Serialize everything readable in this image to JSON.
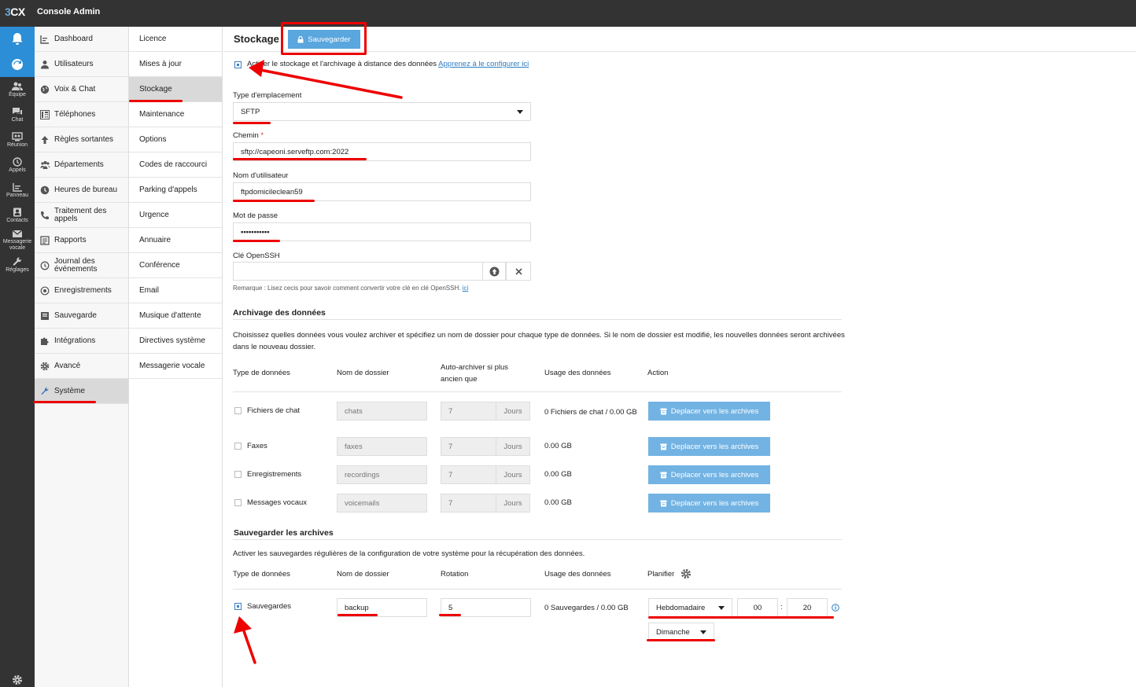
{
  "app": {
    "logo_prefix": "3",
    "logo_suffix": "CX",
    "title": "Console Admin"
  },
  "iconbar": [
    {
      "label": "",
      "icon": "bell-icon"
    },
    {
      "label": "",
      "icon": "refresh-icon"
    },
    {
      "label": "Équipe",
      "icon": "team-icon"
    },
    {
      "label": "Chat",
      "icon": "chat-icon"
    },
    {
      "label": "Réunion",
      "icon": "meeting-icon"
    },
    {
      "label": "Appels",
      "icon": "history-icon"
    },
    {
      "label": "Panneau",
      "icon": "panel-icon"
    },
    {
      "label": "Contacts",
      "icon": "contacts-icon"
    },
    {
      "label": "Messagerie vocale",
      "icon": "mail-icon"
    },
    {
      "label": "Réglages",
      "icon": "wrench-icon"
    }
  ],
  "nav_primary": [
    "Dashboard",
    "Utilisateurs",
    "Voix & Chat",
    "Téléphones",
    "Règles sortantes",
    "Départements",
    "Heures de bureau",
    "Traitement des appels",
    "Rapports",
    "Journal des événements",
    "Enregistrements",
    "Sauvegarde",
    "Intégrations",
    "Avancé",
    "Système"
  ],
  "nav_primary_active": "Système",
  "nav_secondary": [
    "Licence",
    "Mises à jour",
    "Stockage",
    "Maintenance",
    "Options",
    "Codes de raccourci",
    "Parking d'appels",
    "Urgence",
    "Annuaire",
    "Conférence",
    "Email",
    "Musique d'attente",
    "Directives système",
    "Messagerie vocale"
  ],
  "nav_secondary_active": "Stockage",
  "page": {
    "title": "Stockage",
    "save_label": "Sauvegarder"
  },
  "remote": {
    "checkbox_label": "Activer le stockage et l'archivage à distance des données",
    "learn_more": "Apprenez à le configurer ici",
    "checked": true
  },
  "location": {
    "label": "Type d'emplacement",
    "value": "SFTP"
  },
  "path": {
    "label": "Chemin",
    "required_mark": "*",
    "value": "sftp://capeoni.serveftp.com:2022"
  },
  "username": {
    "label": "Nom d'utilisateur",
    "value": "ftpdomicileclean59"
  },
  "password": {
    "label": "Mot de passe",
    "value": "•••••••••••"
  },
  "openssh": {
    "label": "Clé OpenSSH",
    "value": "",
    "note": "Remarque : Lisez cecis pour savoir comment convertir votre clé en clé OpenSSH.",
    "note_link": "ici"
  },
  "archiving": {
    "title": "Archivage des données",
    "description": "Choisissez quelles données vous voulez archiver et spécifiez un nom de dossier pour chaque type de données. Si le nom de dossier est modifié, les nouvelles données seront archivées dans le nouveau dossier.",
    "headers": [
      "Type de données",
      "Nom de dossier",
      "Auto-archiver si plus ancien que",
      "Usage des données",
      "Action"
    ],
    "unit": "Jours",
    "action_label": "Deplacer vers les archives",
    "rows": [
      {
        "type": "Fichiers de chat",
        "folder": "chats",
        "days": "7",
        "usage": "0 Fichiers de chat / 0.00 GB"
      },
      {
        "type": "Faxes",
        "folder": "faxes",
        "days": "7",
        "usage": "0.00 GB"
      },
      {
        "type": "Enregistrements",
        "folder": "recordings",
        "days": "7",
        "usage": "0.00 GB"
      },
      {
        "type": "Messages vocaux",
        "folder": "voicemails",
        "days": "7",
        "usage": "0.00 GB"
      }
    ]
  },
  "backup": {
    "title": "Sauvegarder les archives",
    "description": "Activer les sauvegardes régulières de la configuration de votre système pour la récupération des données.",
    "headers": [
      "Type de données",
      "Nom de dossier",
      "Rotation",
      "Usage des données",
      "Planifier"
    ],
    "row": {
      "type": "Sauvegardes",
      "checked": true,
      "folder": "backup",
      "rotation": "5",
      "usage": "0 Sauvegardes / 0.00 GB",
      "frequency": "Hebdomadaire",
      "hour": "00",
      "separator": ":",
      "minute": "20",
      "day": "Dimanche"
    }
  },
  "colors": {
    "accent": "#2c8ed6",
    "button": "#5aa6de",
    "annotation": "#ee0000",
    "dark": "#333333"
  }
}
